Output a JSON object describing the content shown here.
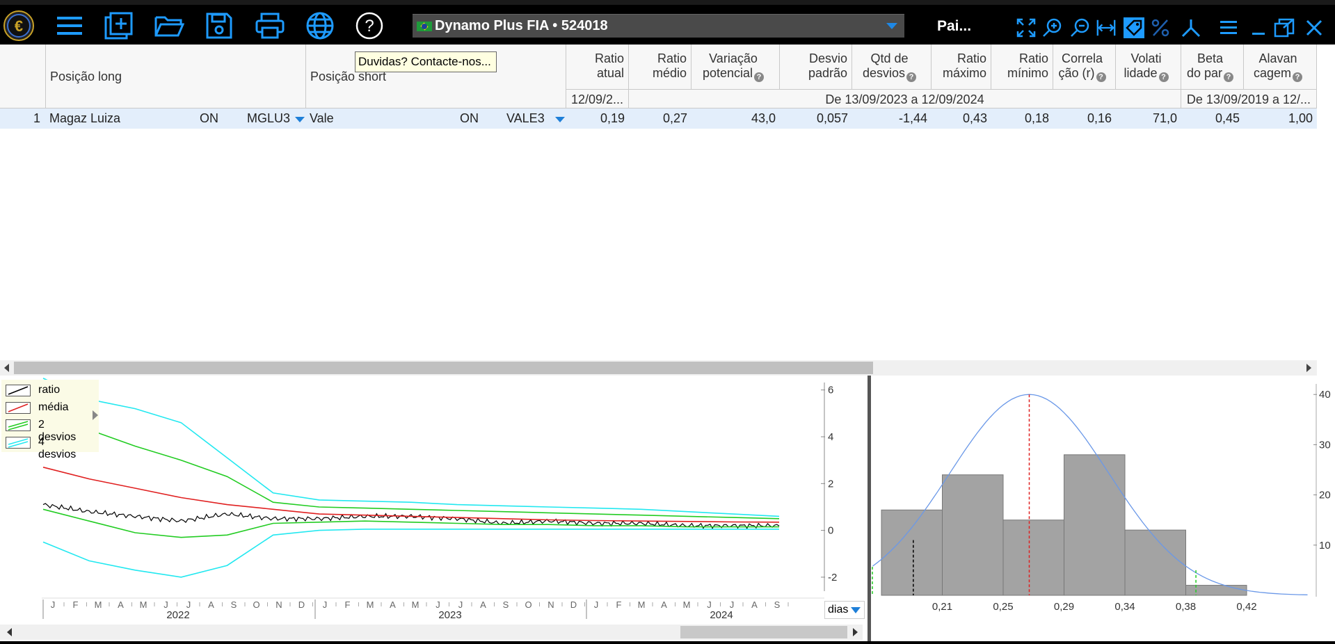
{
  "toolbar": {
    "icons": [
      "euro-logo",
      "hamburger-menu",
      "add-sheet",
      "open-folder",
      "save",
      "print",
      "web-globe",
      "help-question"
    ],
    "account_name": "Dynamo Plus FIA • 524018",
    "right_label": "Pai...",
    "right_icons": [
      "fit-screen",
      "zoom-in",
      "zoom-out",
      "fit-width",
      "tag-filter",
      "percent",
      "graph-fork",
      "menu-lines",
      "minimize",
      "restore",
      "close"
    ]
  },
  "tooltip": "Duvidas? Contacte-nos...",
  "grid": {
    "headers": {
      "long": "Posição long",
      "short": "Posição short",
      "ratio_atual": [
        "Ratio",
        "atual"
      ],
      "ratio_medio": [
        "Ratio",
        "médio"
      ],
      "variacao": [
        "Variação",
        "potencial"
      ],
      "desvio": [
        "Desvio",
        "padrão"
      ],
      "qtd": [
        "Qtd de",
        "desvios"
      ],
      "rmax": [
        "Ratio",
        "máximo"
      ],
      "rmin": [
        "Ratio",
        "mínimo"
      ],
      "correl": [
        "Correla",
        "ção (r)"
      ],
      "volati": [
        "Volati",
        "lidade"
      ],
      "beta": [
        "Beta",
        "do par"
      ],
      "alavan": [
        "Alavan",
        "cagem"
      ]
    },
    "sub": {
      "date_atual": "12/09/2...",
      "range1": "De 13/09/2023 a 12/09/2024",
      "range2": "De 13/09/2019 a 12/..."
    },
    "rows": [
      {
        "index": "1",
        "long_name": "Magaz Luiza",
        "long_class": "ON",
        "long_ticker": "MGLU3",
        "short_name": "Vale",
        "short_class": "ON",
        "short_ticker": "VALE3",
        "ratio_atual": "0,19",
        "ratio_medio": "0,27",
        "variacao": "43,0",
        "desvio": "0,057",
        "qtd": "-1,44",
        "rmax": "0,43",
        "rmin": "0,18",
        "correl": "0,16",
        "volati": "71,0",
        "beta": "0,45",
        "alavan": "1,00"
      }
    ]
  },
  "chart_data": [
    {
      "type": "line",
      "legend": [
        "ratio",
        "média",
        "2 desvios",
        "4 desvios"
      ],
      "colors": {
        "ratio": "#000000",
        "media": "#e02020",
        "dois": "#22cc22",
        "quatro": "#22e8f0"
      },
      "y_ticks": [
        "6",
        "4",
        "2",
        "0",
        "-2"
      ],
      "ylim": [
        -2.3,
        6.2
      ],
      "x_years": [
        "2022",
        "2023",
        "2024"
      ],
      "x_months": [
        "J",
        "F",
        "M",
        "A",
        "M",
        "J",
        "J",
        "A",
        "S",
        "O",
        "N",
        "D"
      ],
      "x": [
        "2022-01",
        "2022-03",
        "2022-05",
        "2022-07",
        "2022-09",
        "2022-11",
        "2023-01",
        "2023-03",
        "2023-05",
        "2023-07",
        "2023-09",
        "2023-11",
        "2024-01",
        "2024-03",
        "2024-05",
        "2024-07",
        "2024-09"
      ],
      "series": [
        {
          "name": "ratio",
          "values": [
            1.1,
            0.8,
            0.6,
            0.4,
            0.7,
            0.5,
            0.5,
            0.6,
            0.6,
            0.5,
            0.3,
            0.4,
            0.3,
            0.3,
            0.2,
            0.2,
            0.2
          ]
        },
        {
          "name": "média",
          "values": [
            2.7,
            2.2,
            1.8,
            1.4,
            1.1,
            0.9,
            0.7,
            0.65,
            0.6,
            0.55,
            0.5,
            0.45,
            0.42,
            0.4,
            0.38,
            0.36,
            0.35
          ]
        },
        {
          "name": "2 desvios (superior)",
          "values": [
            4.9,
            4.3,
            3.6,
            3.0,
            2.3,
            1.2,
            1.0,
            0.95,
            0.9,
            0.85,
            0.8,
            0.75,
            0.7,
            0.65,
            0.6,
            0.55,
            0.5
          ]
        },
        {
          "name": "2 desvios (inferior)",
          "values": [
            0.9,
            0.4,
            -0.1,
            -0.3,
            -0.2,
            0.3,
            0.35,
            0.4,
            0.35,
            0.3,
            0.25,
            0.25,
            0.2,
            0.2,
            0.15,
            0.15,
            0.15
          ]
        },
        {
          "name": "4 desvios (superior)",
          "values": [
            6.5,
            5.6,
            5.2,
            4.6,
            3.1,
            1.6,
            1.3,
            1.25,
            1.2,
            1.1,
            1.05,
            1.0,
            0.95,
            0.9,
            0.8,
            0.7,
            0.6
          ]
        },
        {
          "name": "4 desvios (inferior)",
          "values": [
            -0.5,
            -1.3,
            -1.7,
            -2.0,
            -1.5,
            -0.2,
            0.0,
            0.05,
            0.05,
            0.05,
            0.05,
            0.05,
            0.05,
            0.05,
            0.05,
            0.05,
            0.05
          ]
        }
      ],
      "x_unit_select": "dias"
    },
    {
      "type": "bar",
      "title": "",
      "categories": [
        "0,21",
        "0,25",
        "0,29",
        "0,34",
        "0,38",
        "0,42"
      ],
      "bin_values": [
        17,
        24,
        15,
        28,
        13,
        2
      ],
      "y_ticks": [
        "40",
        "30",
        "20",
        "10"
      ],
      "ylim": [
        0,
        41
      ],
      "markers": {
        "ratio_atual": 0.19,
        "media": 0.27,
        "mais_2_desvios": 0.385
      },
      "normal_curve": {
        "mean": 0.27,
        "peak": 40
      }
    }
  ]
}
